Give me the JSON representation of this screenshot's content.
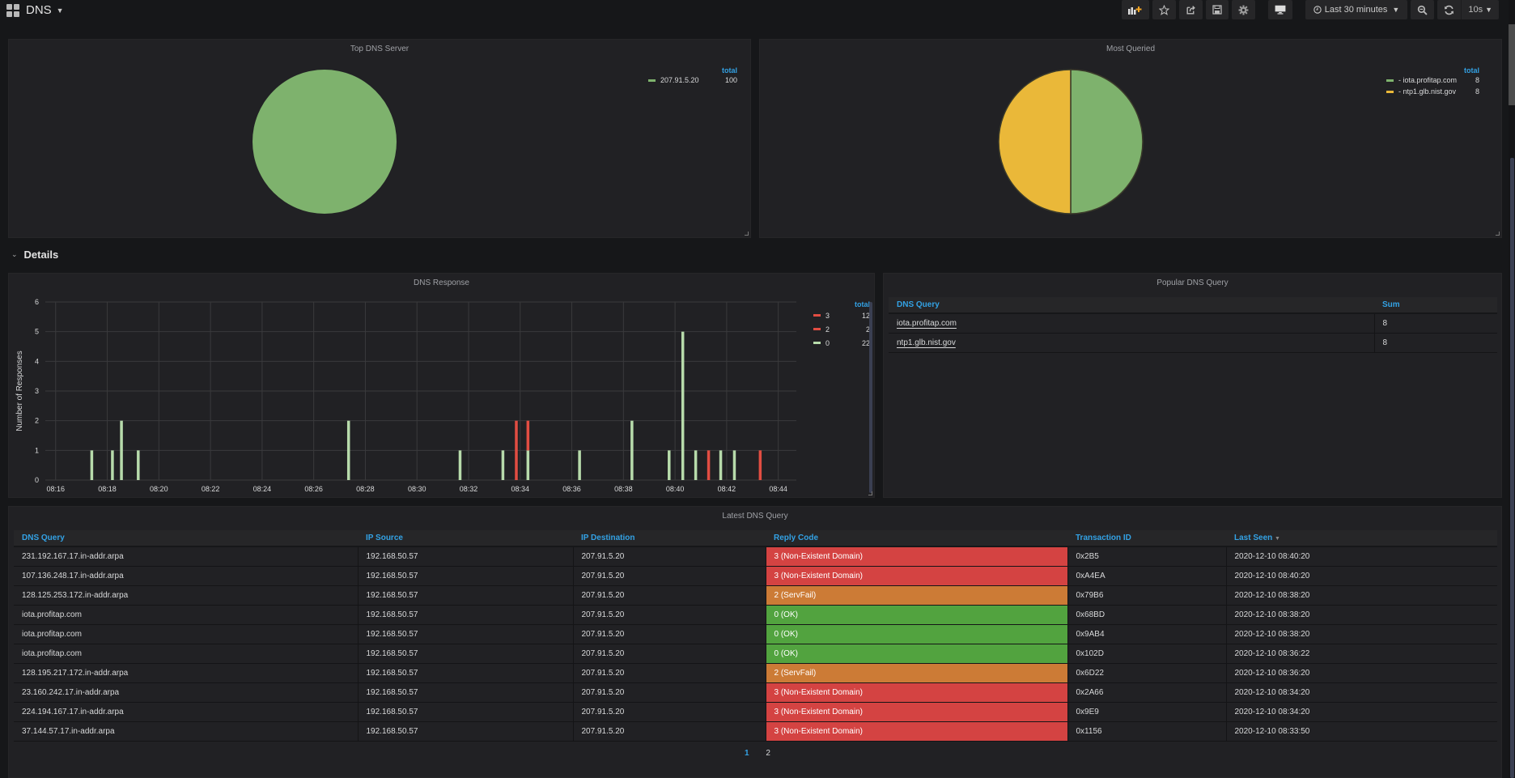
{
  "header": {
    "title": "DNS",
    "toolbar": {
      "add_panel_icon": "bar-chart-plus-icon",
      "star_icon": "star-icon",
      "share_icon": "share-icon",
      "save_icon": "save-icon",
      "settings_icon": "gear-icon",
      "tv_icon": "monitor-icon",
      "time_range": "Last 30 minutes",
      "zoom_out_icon": "zoom-out-icon",
      "refresh_icon": "refresh-icon",
      "refresh_interval": "10s"
    }
  },
  "panels": {
    "top_dns_server": {
      "title": "Top DNS Server",
      "legend_header": "total",
      "legend": [
        {
          "label": "207.91.5.20",
          "value": "100",
          "color": "#7eb26d"
        }
      ]
    },
    "most_queried": {
      "title": "Most Queried",
      "legend_header": "total",
      "legend": [
        {
          "label": "- iota.profitap.com",
          "value": "8",
          "color": "#7eb26d"
        },
        {
          "label": "- ntp1.glb.nist.gov",
          "value": "8",
          "color": "#eab839"
        }
      ]
    },
    "details_row": {
      "title": "Details"
    },
    "dns_response": {
      "title": "DNS Response",
      "legend_header": "total",
      "legend": [
        {
          "label": "3",
          "value": "12",
          "color": "#e24d42"
        },
        {
          "label": "2",
          "value": "2",
          "color": "#e24d42"
        },
        {
          "label": "0",
          "value": "22",
          "color": "#b7dbab"
        }
      ]
    },
    "popular_dns_query": {
      "title": "Popular DNS Query",
      "columns": [
        "DNS Query",
        "Sum"
      ],
      "rows": [
        [
          "iota.profitap.com",
          "8"
        ],
        [
          "ntp1.glb.nist.gov",
          "8"
        ]
      ]
    },
    "latest_dns_query": {
      "title": "Latest DNS Query",
      "columns": [
        "DNS Query",
        "IP Source",
        "IP Destination",
        "Reply Code",
        "Transaction ID",
        "Last Seen"
      ],
      "sort_column": "Last Seen",
      "rows": [
        [
          "231.192.167.17.in-addr.arpa",
          "192.168.50.57",
          "207.91.5.20",
          "3 (Non-Existent Domain)",
          "0x2B5",
          "2020-12-10 08:40:20"
        ],
        [
          "107.136.248.17.in-addr.arpa",
          "192.168.50.57",
          "207.91.5.20",
          "3 (Non-Existent Domain)",
          "0xA4EA",
          "2020-12-10 08:40:20"
        ],
        [
          "128.125.253.172.in-addr.arpa",
          "192.168.50.57",
          "207.91.5.20",
          "2 (ServFail)",
          "0x79B6",
          "2020-12-10 08:38:20"
        ],
        [
          "iota.profitap.com",
          "192.168.50.57",
          "207.91.5.20",
          "0 (OK)",
          "0x68BD",
          "2020-12-10 08:38:20"
        ],
        [
          "iota.profitap.com",
          "192.168.50.57",
          "207.91.5.20",
          "0 (OK)",
          "0x9AB4",
          "2020-12-10 08:38:20"
        ],
        [
          "iota.profitap.com",
          "192.168.50.57",
          "207.91.5.20",
          "0 (OK)",
          "0x102D",
          "2020-12-10 08:36:22"
        ],
        [
          "128.195.217.172.in-addr.arpa",
          "192.168.50.57",
          "207.91.5.20",
          "2 (ServFail)",
          "0x6D22",
          "2020-12-10 08:36:20"
        ],
        [
          "23.160.242.17.in-addr.arpa",
          "192.168.50.57",
          "207.91.5.20",
          "3 (Non-Existent Domain)",
          "0x2A66",
          "2020-12-10 08:34:20"
        ],
        [
          "224.194.167.17.in-addr.arpa",
          "192.168.50.57",
          "207.91.5.20",
          "3 (Non-Existent Domain)",
          "0x9E9",
          "2020-12-10 08:34:20"
        ],
        [
          "37.144.57.17.in-addr.arpa",
          "192.168.50.57",
          "207.91.5.20",
          "3 (Non-Existent Domain)",
          "0x1156",
          "2020-12-10 08:33:50"
        ]
      ],
      "reply_colors": {
        "0": "#52a33f",
        "2": "#cc7b36",
        "3": "#d44342"
      },
      "pagination": [
        "1",
        "2"
      ],
      "active_page": "1"
    }
  },
  "chart_data": [
    {
      "type": "pie",
      "title": "Top DNS Server",
      "labels": [
        "207.91.5.20"
      ],
      "values": [
        100
      ],
      "colors": [
        "#7eb26d"
      ],
      "legend": "right"
    },
    {
      "type": "pie",
      "title": "Most Queried",
      "labels": [
        "iota.profitap.com",
        "ntp1.glb.nist.gov"
      ],
      "values": [
        8,
        8
      ],
      "colors": [
        "#7eb26d",
        "#eab839"
      ],
      "legend": "right"
    },
    {
      "type": "bar",
      "title": "DNS Response",
      "ylabel": "Number of Responses",
      "xlabel": "",
      "ylim": [
        0,
        6
      ],
      "yticks": [
        "0",
        "1",
        "2",
        "3",
        "4",
        "5",
        "6"
      ],
      "xlim": [
        "08:15.6",
        "08:44.7"
      ],
      "xticks": [
        "08:16",
        "08:18",
        "08:20",
        "08:22",
        "08:24",
        "08:26",
        "08:28",
        "08:30",
        "08:32",
        "08:34",
        "08:36",
        "08:38",
        "08:40",
        "08:42",
        "08:44"
      ],
      "grid": true,
      "legend": "right",
      "stacked": true,
      "series": [
        {
          "name": "0",
          "color": "#b7dbab",
          "points": [
            [
              17.4,
              1
            ],
            [
              18.2,
              1
            ],
            [
              18.55,
              2
            ],
            [
              19.2,
              1
            ],
            [
              27.35,
              2
            ],
            [
              31.67,
              1
            ],
            [
              33.33,
              1
            ],
            [
              34.3,
              1
            ],
            [
              36.3,
              1
            ],
            [
              38.33,
              2
            ],
            [
              39.77,
              1
            ],
            [
              40.3,
              5
            ],
            [
              40.8,
              1
            ],
            [
              41.77,
              1
            ],
            [
              42.3,
              1
            ]
          ]
        },
        {
          "name": "2",
          "color": "#e24d42",
          "points": []
        },
        {
          "name": "3",
          "color": "#e24d42",
          "points": [
            [
              33.85,
              2
            ],
            [
              34.3,
              1
            ],
            [
              41.3,
              1
            ],
            [
              43.3,
              1
            ]
          ]
        }
      ]
    }
  ]
}
